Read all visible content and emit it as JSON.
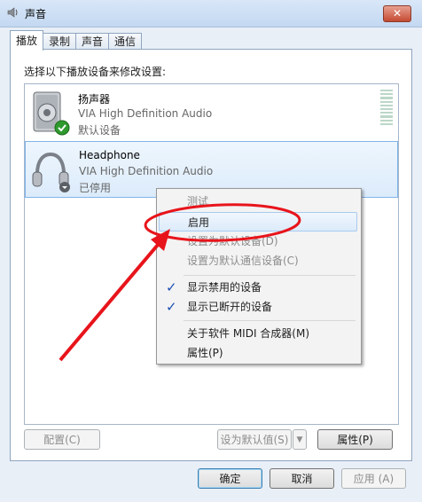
{
  "window": {
    "title": "声音",
    "close_glyph": "✕"
  },
  "tabs": [
    {
      "label": "播放",
      "active": true
    },
    {
      "label": "录制",
      "active": false
    },
    {
      "label": "声音",
      "active": false
    },
    {
      "label": "通信",
      "active": false
    }
  ],
  "instruction": "选择以下播放设备来修改设置:",
  "devices": [
    {
      "name": "扬声器",
      "driver": "VIA High Definition Audio",
      "status": "默认设备",
      "icon": "speaker-icon",
      "badge": "green-check"
    },
    {
      "name": "Headphone",
      "driver": "VIA High Definition Audio",
      "status": "已停用",
      "icon": "headphone-icon",
      "badge": "disabled-arrow"
    }
  ],
  "context_menu": {
    "items": [
      {
        "label": "测试",
        "enabled": false
      },
      {
        "label": "启用",
        "enabled": true,
        "highlighted": true
      },
      {
        "label": "设置为默认设备(D)",
        "enabled": false
      },
      {
        "label": "设置为默认通信设备(C)",
        "enabled": false
      },
      {
        "label": "显示禁用的设备",
        "enabled": true,
        "checked": true
      },
      {
        "label": "显示已断开的设备",
        "enabled": true,
        "checked": true
      },
      {
        "label": "关于软件 MIDI 合成器(M)",
        "enabled": true
      },
      {
        "label": "属性(P)",
        "enabled": true
      }
    ],
    "check_glyph": "✓"
  },
  "buttons": {
    "configure": "配置(C)",
    "set_default": "设为默认值(S)",
    "set_default_arrow": "▼",
    "properties": "属性(P)",
    "ok": "确定",
    "cancel": "取消",
    "apply": "应用 (A)"
  },
  "colors": {
    "annotation": "#e8141b",
    "accent": "#1c4fb3"
  }
}
